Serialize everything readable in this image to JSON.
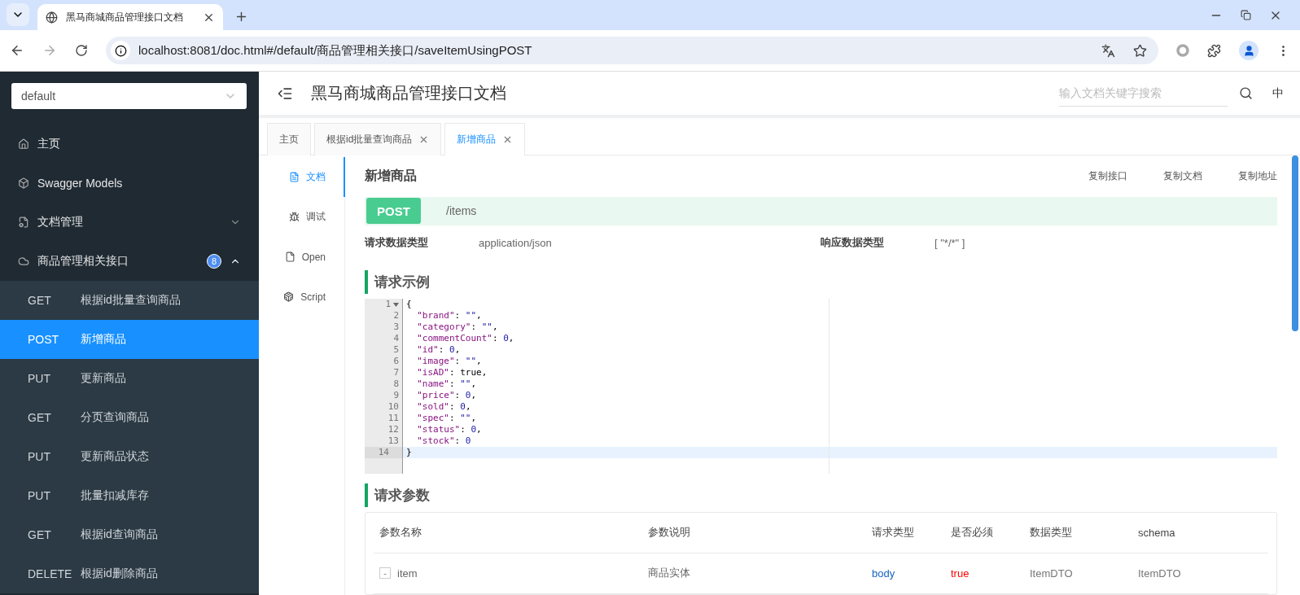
{
  "browser": {
    "tab_title": "黑马商城商品管理接口文档",
    "url": "localhost:8081/doc.html#/default/商品管理相关接口/saveItemUsingPOST"
  },
  "sidebar": {
    "group_select": "default",
    "items": [
      {
        "kind": "nav",
        "label": "主页"
      },
      {
        "kind": "nav",
        "label": "Swagger Models"
      },
      {
        "kind": "folder",
        "label": "文档管理",
        "expanded": false
      },
      {
        "kind": "folder",
        "label": "商品管理相关接口",
        "expanded": true,
        "badge": "8",
        "children": [
          {
            "method": "GET",
            "title": "根据id批量查询商品",
            "selected": false
          },
          {
            "method": "POST",
            "title": "新增商品",
            "selected": true
          },
          {
            "method": "PUT",
            "title": "更新商品",
            "selected": false
          },
          {
            "method": "GET",
            "title": "分页查询商品",
            "selected": false
          },
          {
            "method": "PUT",
            "title": "更新商品状态",
            "selected": false
          },
          {
            "method": "PUT",
            "title": "批量扣减库存",
            "selected": false
          },
          {
            "method": "GET",
            "title": "根据id查询商品",
            "selected": false
          },
          {
            "method": "DELETE",
            "title": "根据id删除商品",
            "selected": false
          }
        ]
      }
    ]
  },
  "header": {
    "title": "黑马商城商品管理接口文档",
    "search_placeholder": "输入文档关键字搜索",
    "language": "中"
  },
  "tabs": [
    {
      "label": "主页",
      "closable": false,
      "selected": false
    },
    {
      "label": "根据id批量查询商品",
      "closable": true,
      "selected": false
    },
    {
      "label": "新增商品",
      "closable": true,
      "selected": true
    }
  ],
  "doc_tabs": [
    {
      "label": "文档",
      "selected": true
    },
    {
      "label": "调试",
      "selected": false
    },
    {
      "label": "Open",
      "selected": false
    },
    {
      "label": "Script",
      "selected": false
    }
  ],
  "api": {
    "title": "新增商品",
    "actions": [
      "复制接口",
      "复制文档",
      "复制地址"
    ],
    "method": "POST",
    "path": "/items",
    "request_type": {
      "label": "请求数据类型",
      "value": "application/json"
    },
    "response_type": {
      "label": "响应数据类型",
      "value": "[ \"*/*\" ]"
    }
  },
  "example": {
    "title": "请求示例",
    "lines": [
      {
        "no": "1",
        "text": "{",
        "fold": true,
        "selected": false
      },
      {
        "no": "2",
        "text": "  \"brand\": \"\",",
        "fold": false,
        "selected": false
      },
      {
        "no": "3",
        "text": "  \"category\": \"\",",
        "fold": false,
        "selected": false
      },
      {
        "no": "4",
        "text": "  \"commentCount\": 0,",
        "fold": false,
        "selected": false
      },
      {
        "no": "5",
        "text": "  \"id\": 0,",
        "fold": false,
        "selected": false
      },
      {
        "no": "6",
        "text": "  \"image\": \"\",",
        "fold": false,
        "selected": false
      },
      {
        "no": "7",
        "text": "  \"isAD\": true,",
        "fold": false,
        "selected": false
      },
      {
        "no": "8",
        "text": "  \"name\": \"\",",
        "fold": false,
        "selected": false
      },
      {
        "no": "9",
        "text": "  \"price\": 0,",
        "fold": false,
        "selected": false
      },
      {
        "no": "10",
        "text": "  \"sold\": 0,",
        "fold": false,
        "selected": false
      },
      {
        "no": "11",
        "text": "  \"spec\": \"\",",
        "fold": false,
        "selected": false
      },
      {
        "no": "12",
        "text": "  \"status\": 0,",
        "fold": false,
        "selected": false
      },
      {
        "no": "13",
        "text": "  \"stock\": 0",
        "fold": false,
        "selected": false
      },
      {
        "no": "14",
        "text": "}",
        "fold": false,
        "selected": true
      }
    ]
  },
  "params": {
    "title": "请求参数",
    "columns": [
      "参数名称",
      "参数说明",
      "请求类型",
      "是否必须",
      "数据类型",
      "schema"
    ],
    "rows": [
      {
        "toggle": "-",
        "cells": [
          "item",
          "商品实体",
          "body",
          "true",
          "ItemDTO",
          "ItemDTO"
        ]
      }
    ]
  }
}
